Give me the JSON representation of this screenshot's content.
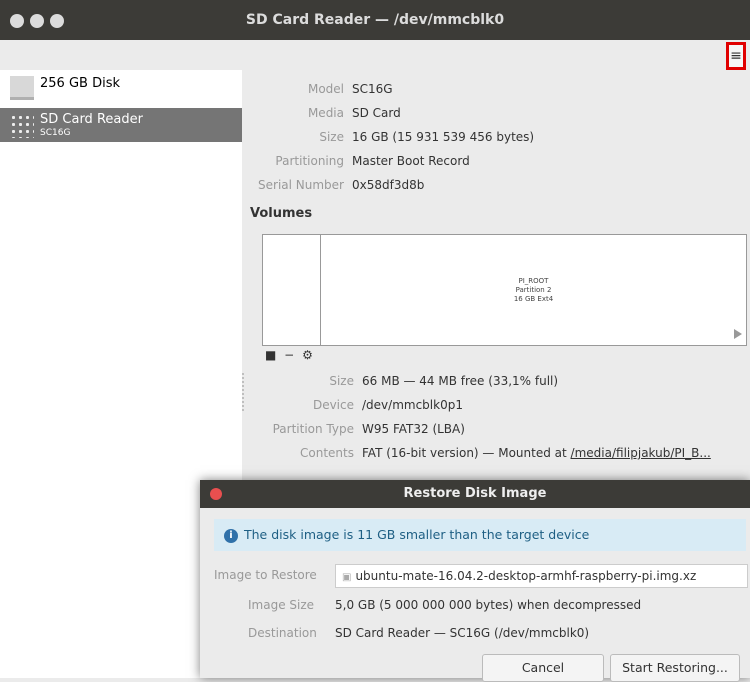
{
  "window": {
    "title": "SD Card Reader — /dev/mmcblk0",
    "menu_icon": "hamburger-menu-icon",
    "menu_glyph": "≡"
  },
  "sidebar": {
    "items": [
      {
        "label": "256 GB Disk",
        "sublabel": "",
        "icon": "disk-icon",
        "selected": false
      },
      {
        "label": "SD Card Reader",
        "sublabel": "SC16G",
        "icon": "sd-card-icon",
        "selected": true
      }
    ]
  },
  "properties": [
    {
      "key": "Model",
      "value": "SC16G"
    },
    {
      "key": "Media",
      "value": "SD Card"
    },
    {
      "key": "Size",
      "value": "16 GB (15 931 539 456 bytes)"
    },
    {
      "key": "Partitioning",
      "value": "Master Boot Record"
    },
    {
      "key": "Serial Number",
      "value": "0x58df3d8b"
    }
  ],
  "volumes": {
    "title": "Volumes",
    "partition_label": [
      "PI_ROOT",
      "Partition 2",
      "16 GB Ext4"
    ],
    "tools": [
      "■",
      "−",
      "⚙"
    ]
  },
  "volume_props": [
    {
      "key": "Size",
      "value": "66 MB — 44 MB free (33,1% full)"
    },
    {
      "key": "Device",
      "value": "/dev/mmcblk0p1"
    },
    {
      "key": "Partition Type",
      "value": "W95 FAT32 (LBA)"
    },
    {
      "key": "Contents",
      "value": "FAT (16-bit version) — Mounted at ",
      "link": "/media/filipjakub/PI_B..."
    }
  ],
  "dialog": {
    "title": "Restore Disk Image",
    "info": "The disk image is 11 GB smaller than the target device",
    "image_label": "Image to Restore",
    "image_value": "ubuntu-mate-16.04.2-desktop-armhf-raspberry-pi.img.xz",
    "size_label": "Image Size",
    "size_value": "5,0 GB (5 000 000 000 bytes) when decompressed",
    "dest_label": "Destination",
    "dest_value": "SD Card Reader — SC16G (/dev/mmcblk0)",
    "cancel": "Cancel",
    "start": "Start Restoring..."
  },
  "colors": {
    "titlebar": "#3c3b37",
    "selection": "#757575",
    "info_bg": "#d8ebf5",
    "highlight": "#e00000"
  }
}
